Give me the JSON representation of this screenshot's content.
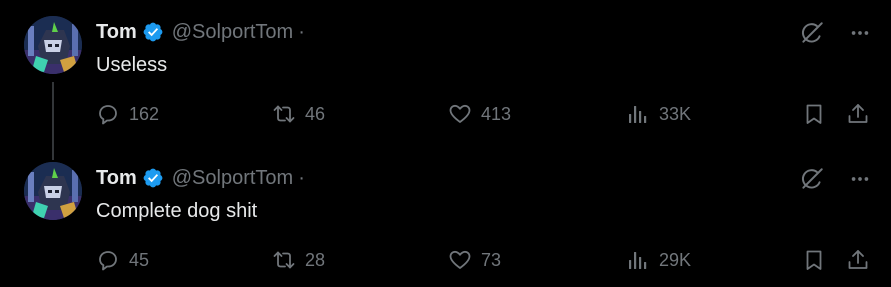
{
  "tweets": [
    {
      "name": "Tom",
      "handle": "@SolportTom",
      "separator": "·",
      "text": "Useless",
      "stats": {
        "replies": "162",
        "reposts": "46",
        "likes": "413",
        "views": "33K"
      }
    },
    {
      "name": "Tom",
      "handle": "@SolportTom",
      "separator": "·",
      "text": "Complete dog shit",
      "stats": {
        "replies": "45",
        "reposts": "28",
        "likes": "73",
        "views": "29K"
      }
    }
  ],
  "colors": {
    "background": "#000000",
    "primary_text": "#e7e9ea",
    "secondary_text": "#71767b",
    "verified_badge": "#1d9bf0",
    "thread_line": "#333639"
  },
  "icons": {
    "verified": "verified-badge-icon",
    "grok": "grok-icon",
    "more": "more-icon",
    "reply": "reply-icon",
    "repost": "repost-icon",
    "like": "heart-icon",
    "views": "views-icon",
    "bookmark": "bookmark-icon",
    "share": "share-icon"
  }
}
